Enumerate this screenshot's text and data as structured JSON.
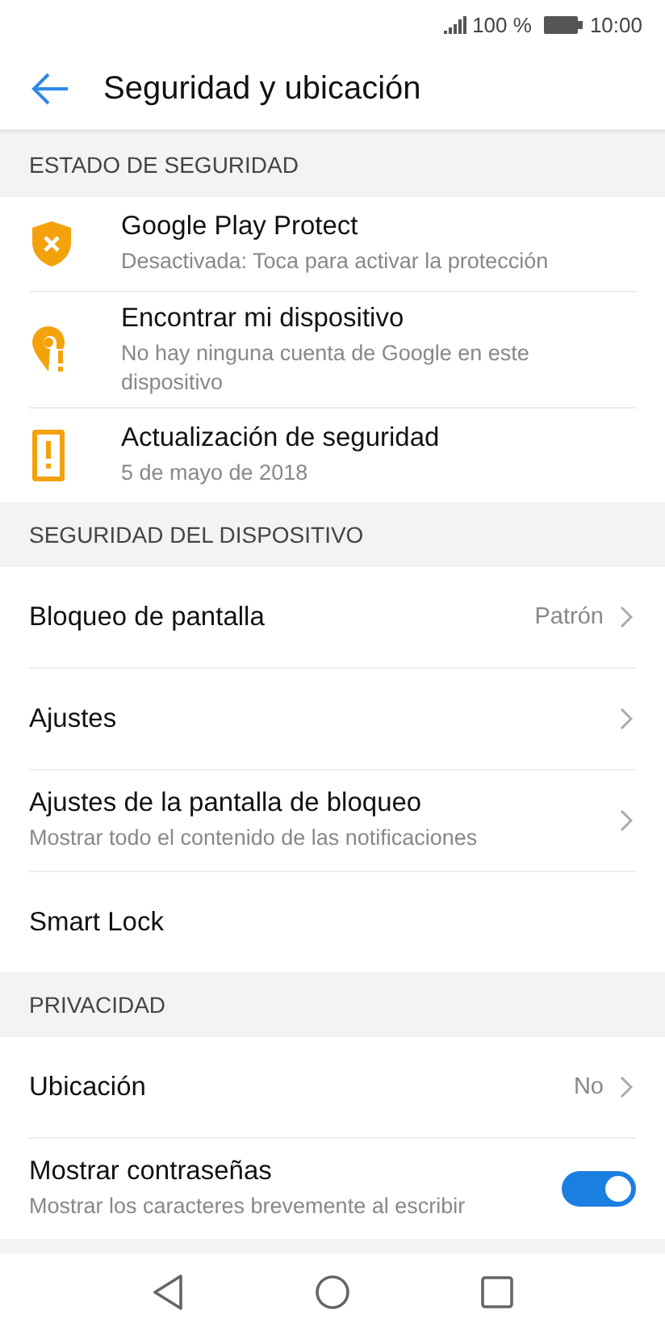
{
  "status_bar": {
    "battery_text": "100 %",
    "time": "10:00"
  },
  "app_bar": {
    "title": "Seguridad y ubicación"
  },
  "sections": [
    {
      "header": "ESTADO DE SEGURIDAD",
      "items": [
        {
          "kind": "status",
          "title": "Google Play Protect",
          "subtitle": "Desactivada: Toca para activar la protección"
        },
        {
          "kind": "status",
          "title": "Encontrar mi dispositivo",
          "subtitle": "No hay ninguna cuenta de Google en este dispositivo"
        },
        {
          "kind": "status",
          "title": "Actualización de seguridad",
          "subtitle": "5 de mayo de 2018"
        }
      ]
    },
    {
      "header": "SEGURIDAD DEL DISPOSITIVO",
      "items": [
        {
          "kind": "link",
          "title": "Bloqueo de pantalla",
          "value": "Patrón",
          "chevron": true
        },
        {
          "kind": "link",
          "title": "Ajustes",
          "chevron": true
        },
        {
          "kind": "link",
          "title": "Ajustes de la pantalla de bloqueo",
          "subtitle": "Mostrar todo el contenido de las notificaciones",
          "chevron": true
        },
        {
          "kind": "link",
          "title": "Smart Lock",
          "chevron": false
        }
      ]
    },
    {
      "header": "PRIVACIDAD",
      "items": [
        {
          "kind": "link",
          "title": "Ubicación",
          "value": "No",
          "chevron": true
        },
        {
          "kind": "toggle",
          "title": "Mostrar contraseñas",
          "subtitle": "Mostrar los caracteres brevemente al escribir",
          "on": true
        }
      ]
    }
  ]
}
